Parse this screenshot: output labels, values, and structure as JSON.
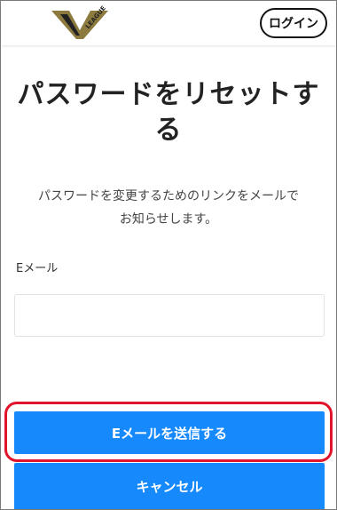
{
  "header": {
    "logo_text": "LEAGUE",
    "login_label": "ログイン"
  },
  "main": {
    "title_line1": "パスワードをリセットす",
    "title_line2": "る",
    "description_line1": "パスワードを変更するためのリンクをメールで",
    "description_line2": "お知らせします。",
    "email_label": "Eメール",
    "email_value": "",
    "send_label": "Eメールを送信する",
    "cancel_label": "キャンセル"
  },
  "colors": {
    "accent_blue": "#1689fc",
    "highlight_red": "#e0142a",
    "logo_gold": "#8c7a3e"
  }
}
